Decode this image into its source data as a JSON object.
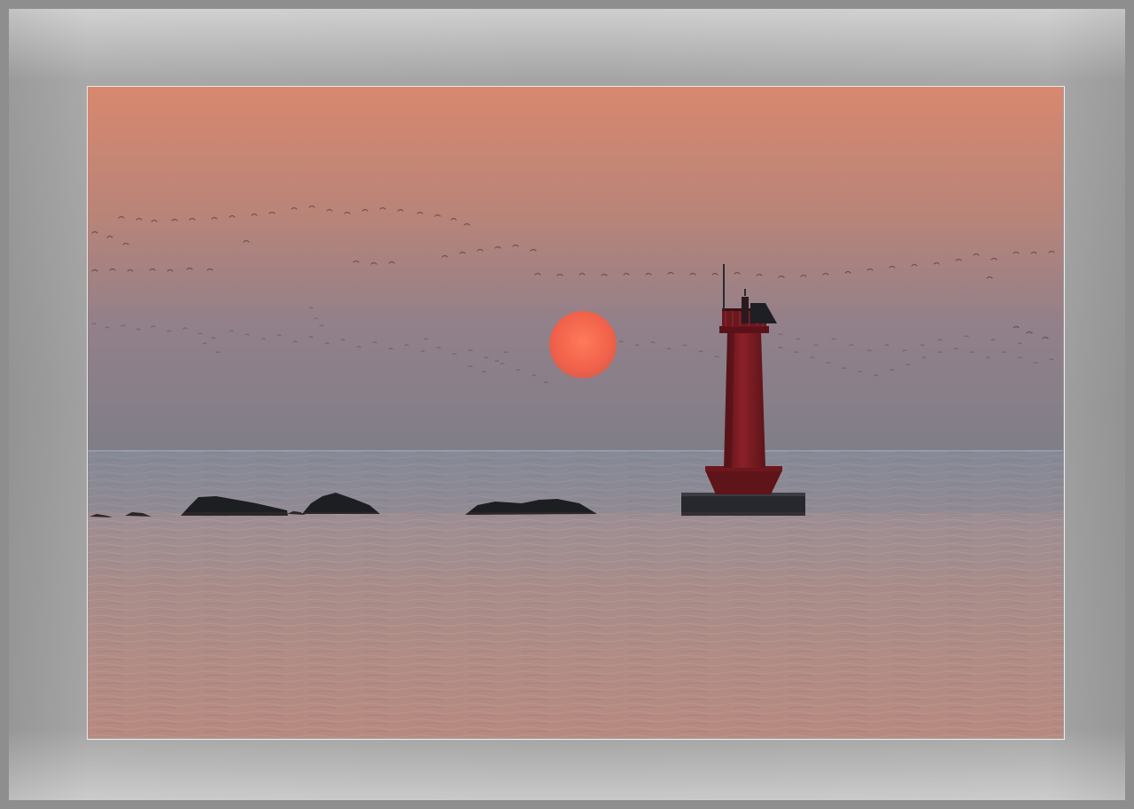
{
  "scene": {
    "subject": "sunset-over-sea-with-lighthouse",
    "colors": {
      "sky_top": "#d8886f",
      "sky_mid": "#9c8180",
      "sky_horizon": "#807e86",
      "sea_top": "#8b8e98",
      "sea_bottom": "#b28a84",
      "sun": "#f2634a",
      "lighthouse": "#7a1b22",
      "rocks": "#1d1e22",
      "mat": "#a0a0a0"
    }
  }
}
